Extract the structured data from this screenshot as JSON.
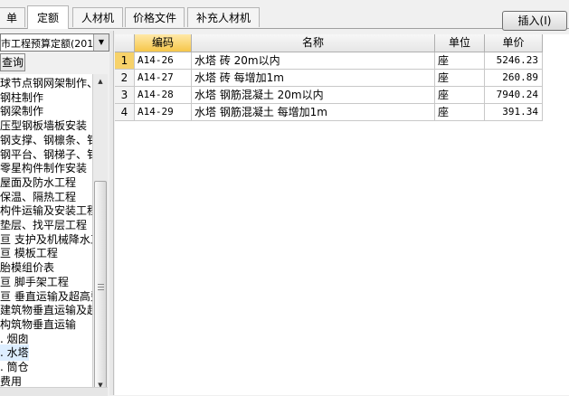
{
  "tabs": [
    {
      "label": "单",
      "active": false
    },
    {
      "label": "定额",
      "active": true
    },
    {
      "label": "人材机",
      "active": false
    },
    {
      "label": "价格文件",
      "active": false
    },
    {
      "label": "补充人材机",
      "active": false
    }
  ],
  "insert_button": "插入(I)",
  "library_combo": {
    "value": "市工程预算定额(201"
  },
  "query_button": "查询",
  "tree_items": [
    "球节点钢网架制作、",
    "钢柱制作",
    "钢梁制作",
    "压型钢板墙板安装",
    "钢支撑、钢檩条、钅",
    "钢平台、钢梯子、钅",
    "零星构件制作安装",
    "屋面及防水工程",
    "保温、隔热工程",
    "构件运输及安装工程",
    "垫层、找平层工程",
    "亘 支护及机械降水工",
    "亘 模板工程",
    "胎模组价表",
    "亘 脚手架工程",
    "亘 垂直运输及超高费",
    "建筑物垂直运输及超",
    "构筑物垂直运输",
    ". 烟囱",
    ". 水塔",
    ". 筒仓",
    "费用"
  ],
  "selected_tree_index": 19,
  "grid": {
    "headers": [
      "",
      "编码",
      "名称",
      "单位",
      "单价"
    ],
    "rows": [
      {
        "no": "1",
        "code": "A14-26",
        "name": "水塔 砖 20m以内",
        "unit": "座",
        "price": "5246.23"
      },
      {
        "no": "2",
        "code": "A14-27",
        "name": "水塔 砖 每增加1m",
        "unit": "座",
        "price": "260.89"
      },
      {
        "no": "3",
        "code": "A14-28",
        "name": "水塔 钢筋混凝土 20m以内",
        "unit": "座",
        "price": "7940.24"
      },
      {
        "no": "4",
        "code": "A14-29",
        "name": "水塔 钢筋混凝土 每增加1m",
        "unit": "座",
        "price": "391.34"
      }
    ]
  },
  "colors": {
    "selected_header": "#f6c64a",
    "current_row": "#f7d26a"
  }
}
